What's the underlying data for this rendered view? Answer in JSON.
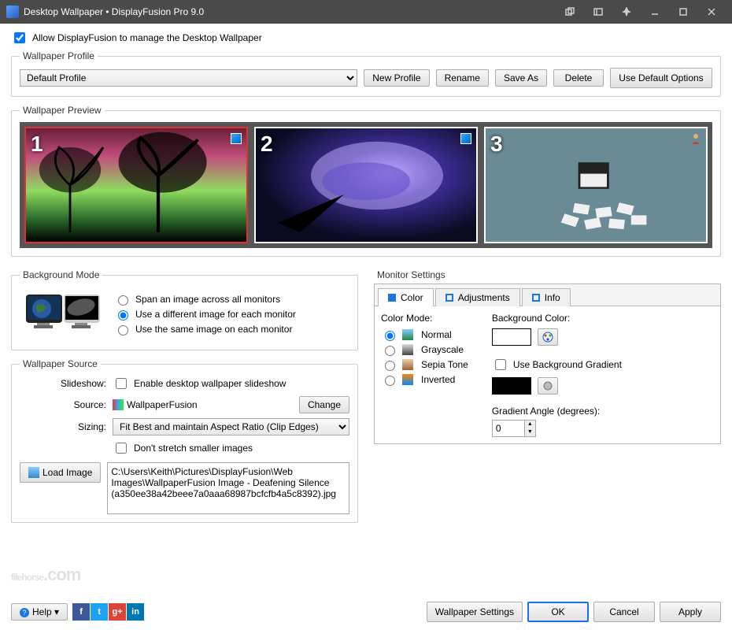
{
  "titlebar": {
    "title": "Desktop Wallpaper • DisplayFusion Pro 9.0"
  },
  "allow_manage": {
    "label": "Allow DisplayFusion to manage the Desktop Wallpaper",
    "checked": true
  },
  "profile": {
    "legend": "Wallpaper Profile",
    "selected": "Default Profile",
    "btn_new": "New Profile",
    "btn_rename": "Rename",
    "btn_saveas": "Save As",
    "btn_delete": "Delete",
    "btn_default": "Use Default Options"
  },
  "preview": {
    "legend": "Wallpaper Preview",
    "monitors": [
      "1",
      "2",
      "3"
    ]
  },
  "bgmode": {
    "legend": "Background Mode",
    "opts": {
      "span": "Span an image across all monitors",
      "diff": "Use a different image for each monitor",
      "same": "Use the same image on each monitor"
    },
    "selected": "diff"
  },
  "source": {
    "legend": "Wallpaper Source",
    "slideshow_label": "Slideshow:",
    "enable_slideshow": "Enable desktop wallpaper slideshow",
    "source_label": "Source:",
    "source_value": "WallpaperFusion",
    "change": "Change",
    "sizing_label": "Sizing:",
    "sizing_value": "Fit Best and maintain Aspect Ratio (Clip Edges)",
    "dont_stretch": "Don't stretch smaller images",
    "load_image": "Load Image",
    "path": "C:\\Users\\Keith\\Pictures\\DisplayFusion\\Web Images\\WallpaperFusion Image - Deafening Silence (a350ee38a42beee7a0aaa68987bcfcfb4a5c8392).jpg"
  },
  "monitor": {
    "legend": "Monitor Settings",
    "tab_color": "Color",
    "tab_adjust": "Adjustments",
    "tab_info": "Info",
    "color_mode_label": "Color Mode:",
    "modes": {
      "normal": "Normal",
      "grayscale": "Grayscale",
      "sepia": "Sepia Tone",
      "inverted": "Inverted"
    },
    "bgcolor_label": "Background Color:",
    "use_gradient": "Use Background Gradient",
    "gradient_angle_label": "Gradient Angle (degrees):",
    "gradient_angle": "0"
  },
  "footer": {
    "help": "Help",
    "wallpaper_settings": "Wallpaper Settings",
    "ok": "OK",
    "cancel": "Cancel",
    "apply": "Apply"
  },
  "watermark": {
    "a": "filehorse",
    "b": ".com"
  }
}
